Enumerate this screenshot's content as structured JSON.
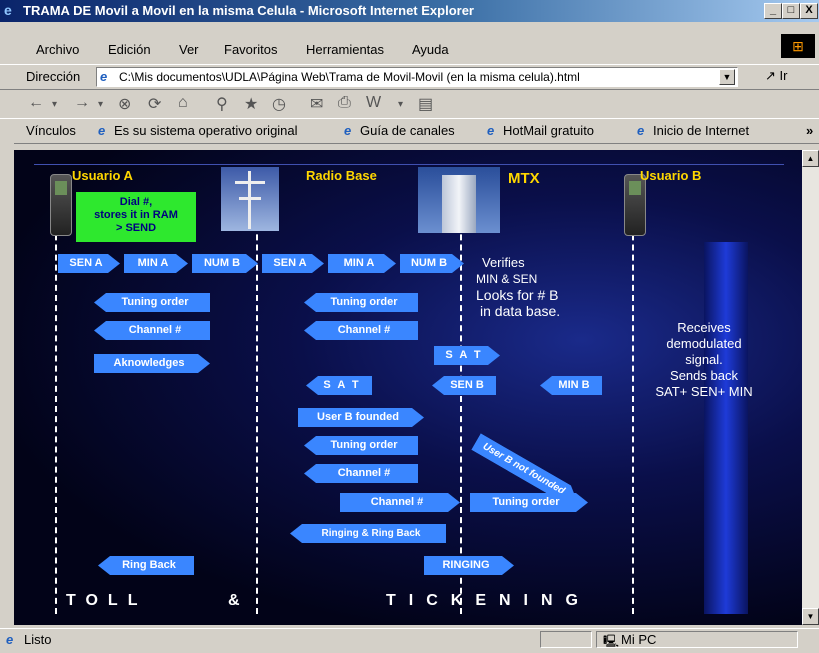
{
  "window": {
    "title": "TRAMA DE Movil a Movil en la misma Celula - Microsoft Internet Explorer",
    "min_glyph": "_",
    "max_glyph": "□",
    "close_glyph": "X"
  },
  "menu": [
    "Archivo",
    "Edición",
    "Ver",
    "Favoritos",
    "Herramientas",
    "Ayuda"
  ],
  "address": {
    "label": "Dirección",
    "value": "C:\\Mis documentos\\UDLA\\Página Web\\Trama de Movil-Movil (en la misma celula).html",
    "go_label": "Ir"
  },
  "links": {
    "label": "Vínculos",
    "items": [
      "Es su sistema operativo original",
      "Guía de canales",
      "HotMail gratuito",
      "Inicio de Internet"
    ],
    "more": "»"
  },
  "diagram": {
    "headers": {
      "usuario_a": "Usuario A",
      "radio_base": "Radio Base",
      "mtx": "MTX",
      "usuario_b": "Usuario B"
    },
    "green_box": [
      "Dial #,",
      "stores it in RAM",
      "> SEND"
    ],
    "arrows": {
      "sen_a_1": "SEN A",
      "min_a_1": "MIN A",
      "num_b_1": "NUM B",
      "sen_a_2": "SEN A",
      "min_a_2": "MIN A",
      "num_b_2": "NUM B",
      "tuning_1": "Tuning order",
      "tuning_2": "Tuning order",
      "channel_1": "Channel  #",
      "channel_2": "Channel  #",
      "aknowledges": "Aknowledges",
      "sat_right": "S A T",
      "sat_left": "S A T",
      "sen_b": "SEN B",
      "min_b": "MIN B",
      "user_b_founded": "User B founded",
      "tuning_3": "Tuning order",
      "channel_3": "Channel  #",
      "user_b_not_founded": "User B not founded",
      "channel_4": "Channel #",
      "tuning_4": "Tuning order",
      "ringing_ringback": "Ringing & Ring Back",
      "ring_back": "Ring Back",
      "ringing": "RINGING"
    },
    "notes": {
      "verifies": [
        "Verifies",
        "MIN & SEN",
        "Looks for # B",
        "in data base."
      ],
      "receives": [
        "Receives",
        "demodulated",
        "signal.",
        "Sends back",
        "SAT+ SEN+ MIN"
      ]
    },
    "footer": {
      "toll": "TOLL",
      "amp": "&",
      "tickening": "TICKENING"
    }
  },
  "status": {
    "text": "Listo",
    "zone": "Mi PC"
  }
}
